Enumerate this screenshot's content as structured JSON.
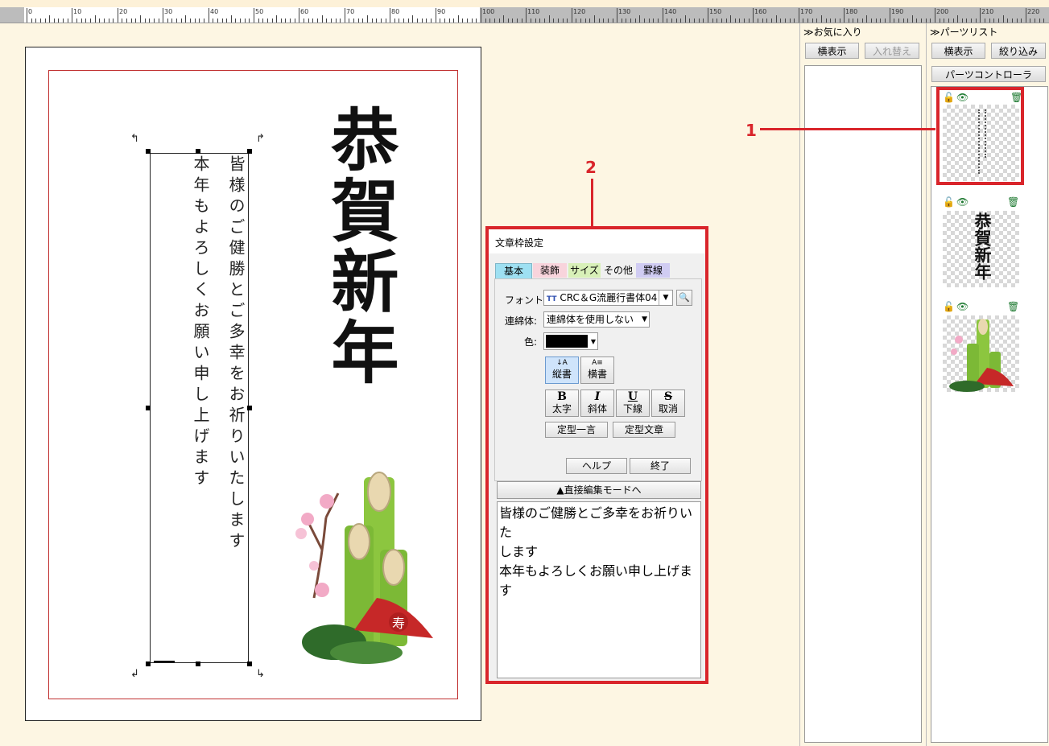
{
  "ruler": {
    "labels": [
      "0",
      "10",
      "20",
      "30",
      "40",
      "50",
      "60",
      "70",
      "80",
      "90",
      "100",
      "110",
      "120",
      "130",
      "140",
      "150",
      "160",
      "170",
      "180",
      "190",
      "200",
      "210",
      "220"
    ]
  },
  "card": {
    "greeting": "恭賀新年",
    "line1": "皆様のご健勝とご多幸をお祈りいたします",
    "line2": "本年もよろしくお願い申し上げます"
  },
  "favorites": {
    "title": "≫お気に入り",
    "view_button": "横表示",
    "swap_button": "入れ替え"
  },
  "parts": {
    "title": "≫パーツリスト",
    "view_button": "横表示",
    "filter_button": "絞り込み",
    "controller_button": "パーツコントローラ",
    "thumb_greeting_text": "恭賀新年"
  },
  "callouts": {
    "one": "1",
    "two": "2"
  },
  "dialog": {
    "title": "文章枠設定",
    "tabs": [
      "基本",
      "装飾",
      "サイズ",
      "その他",
      "罫線"
    ],
    "font_label": "フォント:",
    "font_icon": "TT",
    "font_value": "CRC＆G流麗行書体04",
    "connect_label": "連綿体:",
    "connect_value": "連綿体を使用しない",
    "color_label": "色:",
    "vertical_icon": "↓A",
    "vertical_label": "縦書",
    "horizontal_icon": "A≡",
    "horizontal_label": "横書",
    "bold_icon": "B",
    "bold_label": "太字",
    "italic_icon": "I",
    "italic_label": "斜体",
    "underline_icon": "U",
    "underline_label": "下線",
    "strike_icon": "S",
    "strike_label": "取消",
    "phrase_button": "定型一言",
    "template_button": "定型文章",
    "help_button": "ヘルプ",
    "close_button": "終了",
    "direct_edit_button": "▲直接編集モードへ",
    "text_content_line1": "皆様のご健勝とご多幸をお祈りいた",
    "text_content_line2": "します",
    "text_content_line3": "本年もよろしくお願い申し上げます"
  },
  "colors": {
    "accent_red": "#d9252b",
    "text_color": "#000000"
  }
}
